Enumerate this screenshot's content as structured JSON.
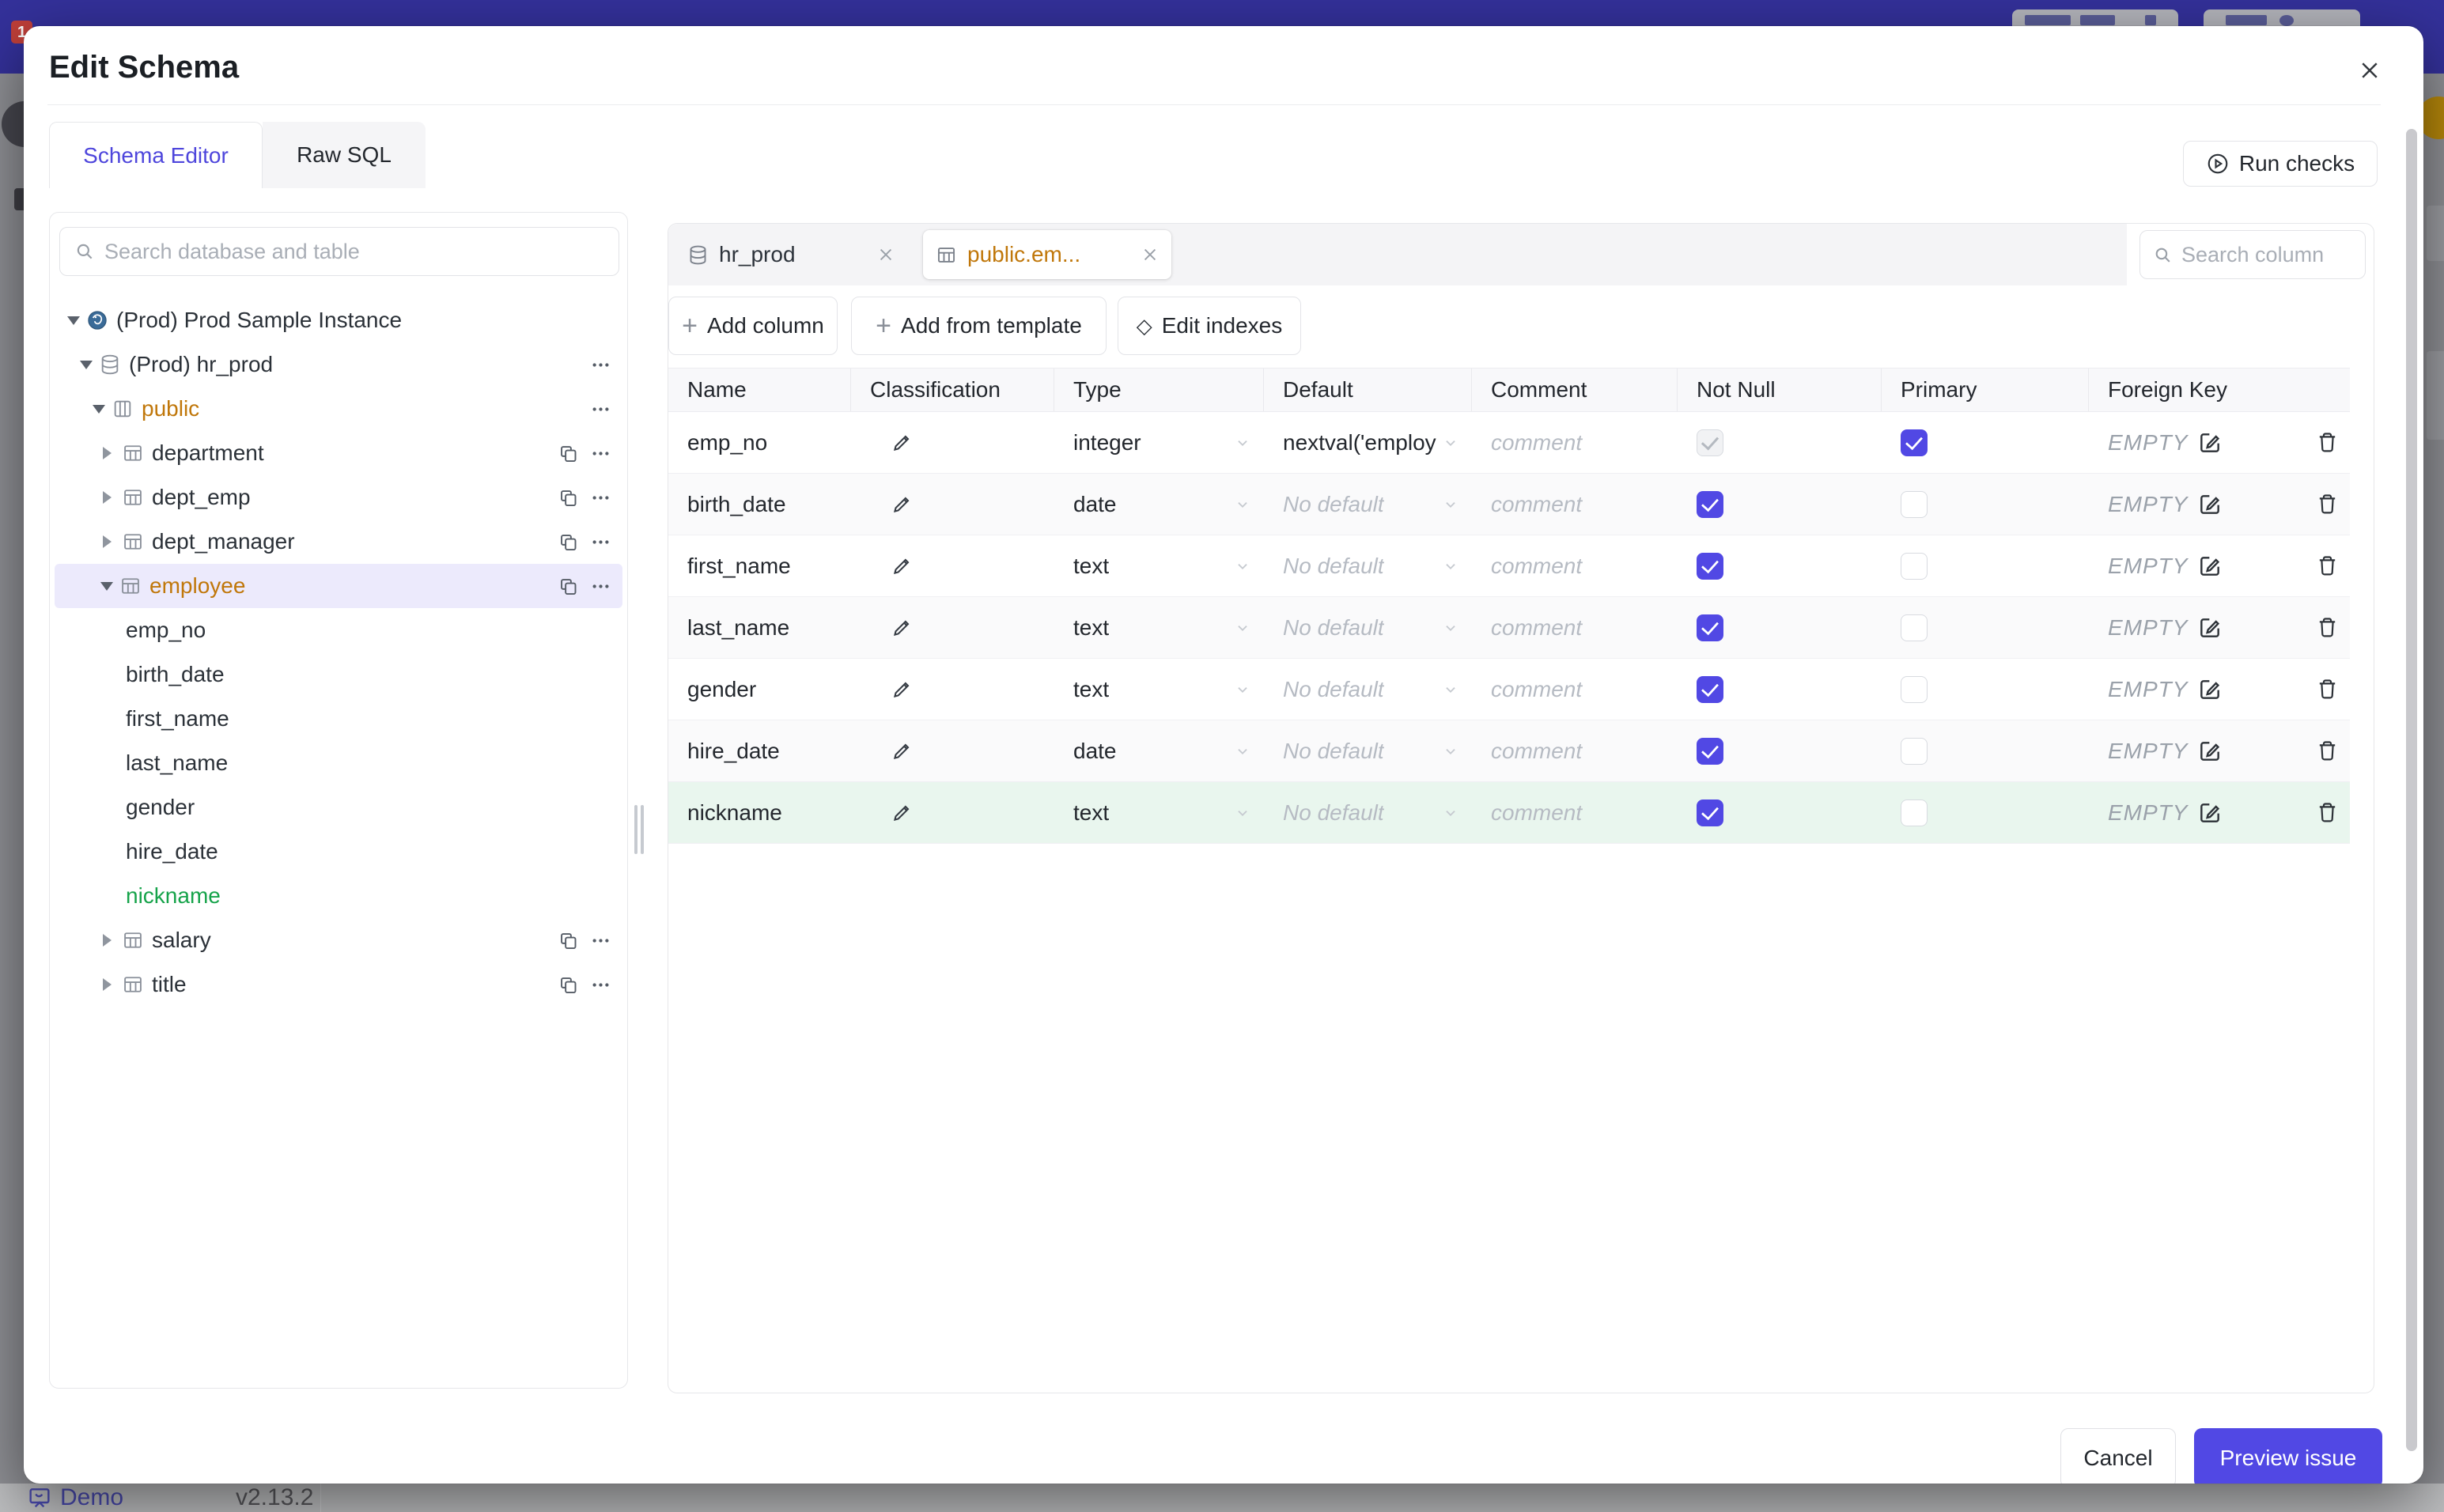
{
  "colors": {
    "accent": "#5148e4",
    "modified_orange": "#c0770a",
    "new_green": "#16a34a",
    "new_row_bg": "#e9f6ee",
    "selected_row_bg": "#eceafc",
    "topbar": "#34319b"
  },
  "backdrop": {
    "badge": "1",
    "brand": "Demo",
    "version": "v2.13.2"
  },
  "modal": {
    "title": "Edit Schema",
    "tabs": {
      "schema_editor": "Schema Editor",
      "raw_sql": "Raw SQL"
    },
    "run_checks_label": "Run checks",
    "footer": {
      "cancel_label": "Cancel",
      "submit_label": "Preview issue"
    }
  },
  "left_panel": {
    "search_placeholder": "Search database and table",
    "tree": [
      {
        "cls": "lvl-instance",
        "co": true,
        "f_pg": true,
        "label": "(Prod) Prod Sample Instance"
      },
      {
        "cls": "lvl-db",
        "co": true,
        "f_db": true,
        "label": "(Prod) hr_prod",
        "f_dots": true
      },
      {
        "cls": "lvl-schema t-orange",
        "co": true,
        "f_schema": true,
        "label": "public",
        "f_dots": true
      },
      {
        "cls": "lvl-table",
        "cc": true,
        "f_table": true,
        "label": "department",
        "f_copy": true,
        "f_dots": true
      },
      {
        "cls": "lvl-table",
        "cc": true,
        "f_table": true,
        "label": "dept_emp",
        "f_copy": true,
        "f_dots": true
      },
      {
        "cls": "lvl-table",
        "cc": true,
        "f_table": true,
        "label": "dept_manager",
        "f_copy": true,
        "f_dots": true
      },
      {
        "cls": "lvl-table sel t-orange",
        "co": true,
        "f_table": true,
        "label": "employee",
        "f_copy": true,
        "f_dots": true
      },
      {
        "cls": "lvl-leaf",
        "label": "emp_no"
      },
      {
        "cls": "lvl-leaf",
        "label": "birth_date"
      },
      {
        "cls": "lvl-leaf",
        "label": "first_name"
      },
      {
        "cls": "lvl-leaf",
        "label": "last_name"
      },
      {
        "cls": "lvl-leaf",
        "label": "gender"
      },
      {
        "cls": "lvl-leaf",
        "label": "hire_date"
      },
      {
        "cls": "lvl-leaf t-green",
        "label": "nickname"
      },
      {
        "cls": "lvl-table",
        "cc": true,
        "f_table": true,
        "label": "salary",
        "f_copy": true,
        "f_dots": true
      },
      {
        "cls": "lvl-table",
        "cc": true,
        "f_table": true,
        "label": "title",
        "f_copy": true,
        "f_dots": true
      }
    ]
  },
  "editor": {
    "chips": {
      "db_chip": "hr_prod",
      "table_chip": "public.em..."
    },
    "search_placeholder": "Search column",
    "actions": {
      "add_column": "Add column",
      "add_from_template": "Add from template",
      "edit_indexes": "Edit indexes"
    },
    "table": {
      "columns": [
        "Name",
        "Classification",
        "Type",
        "Default",
        "Comment",
        "Not Null",
        "Primary",
        "Foreign Key"
      ],
      "comment_placeholder": "comment",
      "fk_value": "EMPTY",
      "rows": [
        {
          "name": "emp_no",
          "type": "integer",
          "default_text": "nextval('employ",
          "dcls": "",
          "nn": "cb-dis",
          "pk": "cb-on",
          "cls": ""
        },
        {
          "name": "birth_date",
          "type": "date",
          "default_text": "No default",
          "dcls": "mut",
          "nn": "cb-on",
          "pk": "cb-off",
          "cls": "stripe"
        },
        {
          "name": "first_name",
          "type": "text",
          "default_text": "No default",
          "dcls": "mut",
          "nn": "cb-on",
          "pk": "cb-off",
          "cls": ""
        },
        {
          "name": "last_name",
          "type": "text",
          "default_text": "No default",
          "dcls": "mut",
          "nn": "cb-on",
          "pk": "cb-off",
          "cls": "stripe"
        },
        {
          "name": "gender",
          "type": "text",
          "default_text": "No default",
          "dcls": "mut",
          "nn": "cb-on",
          "pk": "cb-off",
          "cls": ""
        },
        {
          "name": "hire_date",
          "type": "date",
          "default_text": "No default",
          "dcls": "mut",
          "nn": "cb-on",
          "pk": "cb-off",
          "cls": "stripe"
        },
        {
          "name": "nickname",
          "type": "text",
          "default_text": "No default",
          "dcls": "mut",
          "nn": "cb-on",
          "pk": "cb-off",
          "cls": "green"
        }
      ]
    }
  }
}
